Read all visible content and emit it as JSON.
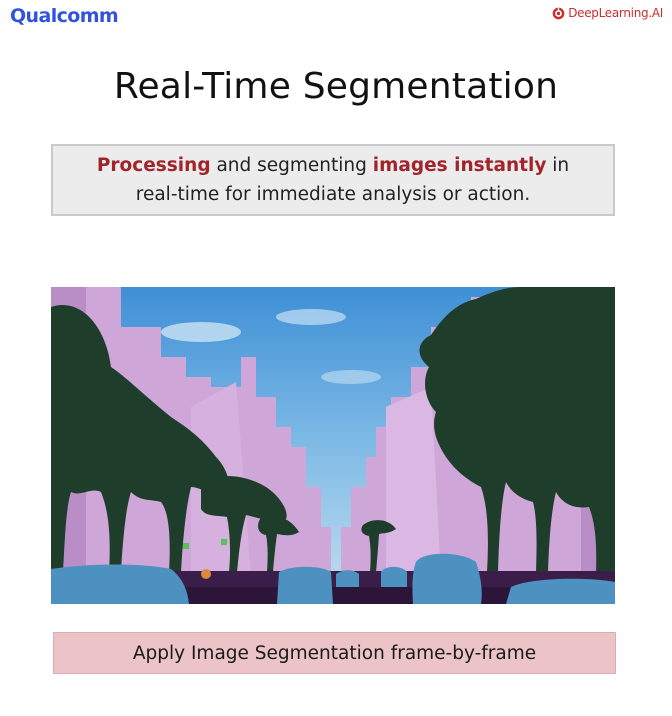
{
  "header": {
    "left_logo_text": "Qualcomm",
    "right_logo_text": "DeepLearning.AI",
    "brand_color_left": "#3253DC",
    "brand_color_right": "#c8312c"
  },
  "slide": {
    "title": "Real-Time Segmentation",
    "description": {
      "line1": [
        {
          "text": "Processing",
          "highlight": true
        },
        {
          "text": " and segmenting ",
          "highlight": false
        },
        {
          "text": "images instantly",
          "highlight": true
        },
        {
          "text": " in",
          "highlight": false
        }
      ],
      "line2": "real-time for immediate analysis or action.",
      "highlight_color": "#a1242b"
    },
    "image": {
      "icon": "segmented-street-scene-image",
      "class_colors": {
        "sky": "#8ab8e0",
        "building": "#c9a3d6",
        "vegetation": "#1e3d2a",
        "car": "#4c91c0",
        "road": "#3a1d48"
      }
    },
    "caption": "Apply Image Segmentation frame-by-frame"
  }
}
